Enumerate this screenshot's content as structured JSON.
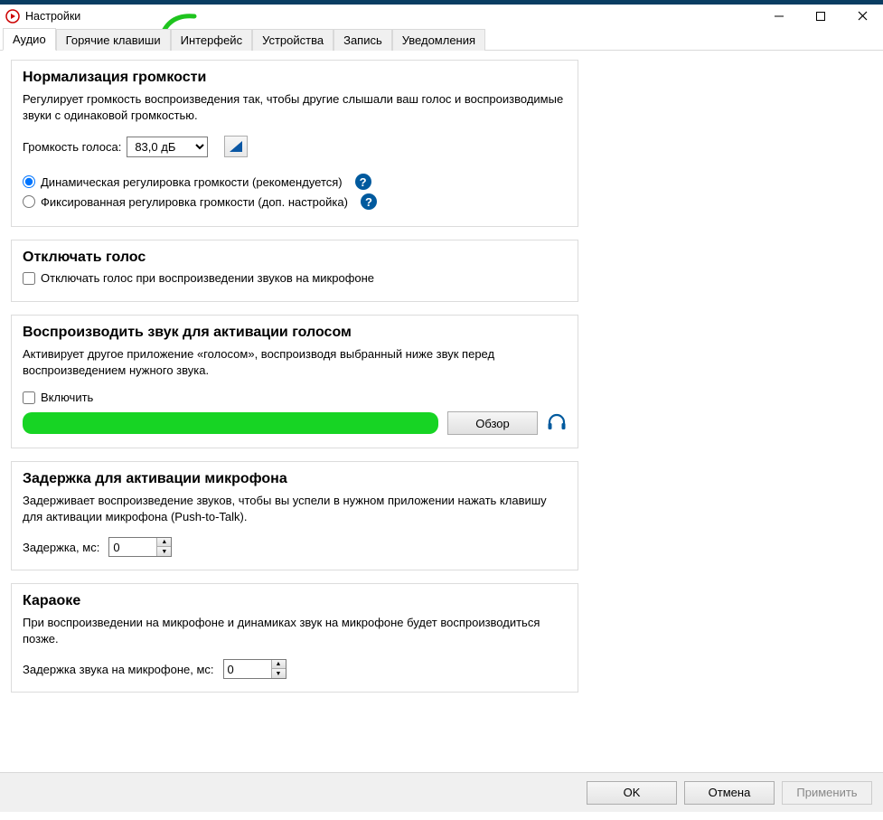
{
  "window": {
    "title": "Настройки"
  },
  "tabs": [
    "Аудио",
    "Горячие клавиши",
    "Интерфейс",
    "Устройства",
    "Запись",
    "Уведомления"
  ],
  "active_tab": 0,
  "groups": {
    "normalization": {
      "title": "Нормализация громкости",
      "desc": "Регулирует громкость воспроизведения так, чтобы другие слышали ваш голос и воспроизводимые звуки с одинаковой громкостью.",
      "volume_label": "Громкость голоса:",
      "volume_value": "83,0 дБ",
      "radio_dynamic": "Динамическая регулировка громкости (рекомендуется)",
      "radio_fixed": "Фиксированная регулировка громкости (доп. настройка)"
    },
    "mute": {
      "title": "Отключать голос",
      "checkbox": "Отключать голос при воспроизведении звуков на микрофоне"
    },
    "activation_sound": {
      "title": "Воспроизводить звук для активации голосом",
      "desc": "Активирует другое приложение «голосом», воспроизводя выбранный ниже звук перед воспроизведением нужного звука.",
      "enable": "Включить",
      "browse": "Обзор"
    },
    "mic_delay": {
      "title": "Задержка для активации микрофона",
      "desc": "Задерживает воспроизведение звуков, чтобы вы успели в нужном приложении нажать клавишу для активации микрофона (Push-to-Talk).",
      "label": "Задержка, мс:",
      "value": "0"
    },
    "karaoke": {
      "title": "Караоке",
      "desc": "При воспроизведении на микрофоне и динамиках звук на микрофоне будет воспроизводиться позже.",
      "label": "Задержка звука на микрофоне, мс:",
      "value": "0"
    }
  },
  "footer": {
    "ok": "OK",
    "cancel": "Отмена",
    "apply": "Применить"
  }
}
